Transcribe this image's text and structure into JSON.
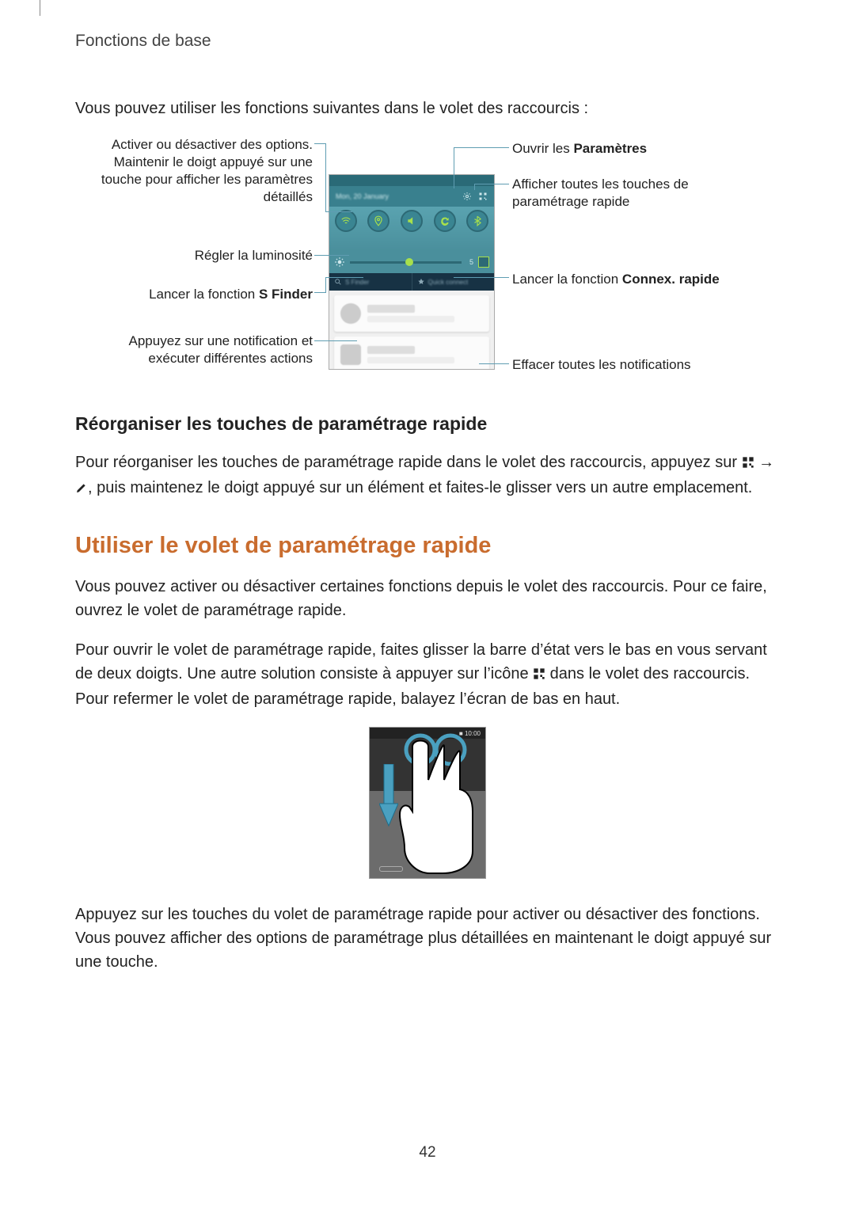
{
  "header": {
    "breadcrumb": "Fonctions de base"
  },
  "intro": "Vous pouvez utiliser les fonctions suivantes dans le volet des raccourcis :",
  "figure1": {
    "callouts": {
      "activate": "Activer ou désactiver des options. Maintenir le doigt appuyé sur une touche pour afficher les paramètres détaillés",
      "brightness": "Régler la luminosité",
      "sfinder_prefix": "Lancer la fonction ",
      "sfinder_bold": "S Finder",
      "notification": "Appuyez sur une notification et exécuter différentes actions",
      "open_settings_prefix": "Ouvrir les ",
      "open_settings_bold": "Paramètres",
      "show_all": "Afficher toutes les touches de paramétrage rapide",
      "quick_connect_prefix": "Lancer la fonction ",
      "quick_connect_bold": "Connex. rapide",
      "clear": "Effacer toutes les notifications"
    },
    "brightness_value": "5"
  },
  "reorganize": {
    "heading": "Réorganiser les touches de paramétrage rapide",
    "p1a": "Pour réorganiser les touches de paramétrage rapide dans le volet des raccourcis, appuyez sur ",
    "p1b": " → ",
    "p1c": ", puis maintenez le doigt appuyé sur un élément et faites-le glisser vers un autre emplacement."
  },
  "quick_panel": {
    "heading": "Utiliser le volet de paramétrage rapide",
    "p1": "Vous pouvez activer ou désactiver certaines fonctions depuis le volet des raccourcis. Pour ce faire, ouvrez le volet de paramétrage rapide.",
    "p2a": "Pour ouvrir le volet de paramétrage rapide, faites glisser la barre d’état vers le bas en vous servant de deux doigts. Une autre solution consiste à appuyer sur l’icône ",
    "p2b": " dans le volet des raccourcis. Pour refermer le volet de paramétrage rapide, balayez l’écran de bas en haut.",
    "p3": "Appuyez sur les touches du volet de paramétrage rapide pour activer ou désactiver des fonctions. Vous pouvez afficher des options de paramétrage plus détaillées en maintenant le doigt appuyé sur une touche."
  },
  "page_number": "42"
}
